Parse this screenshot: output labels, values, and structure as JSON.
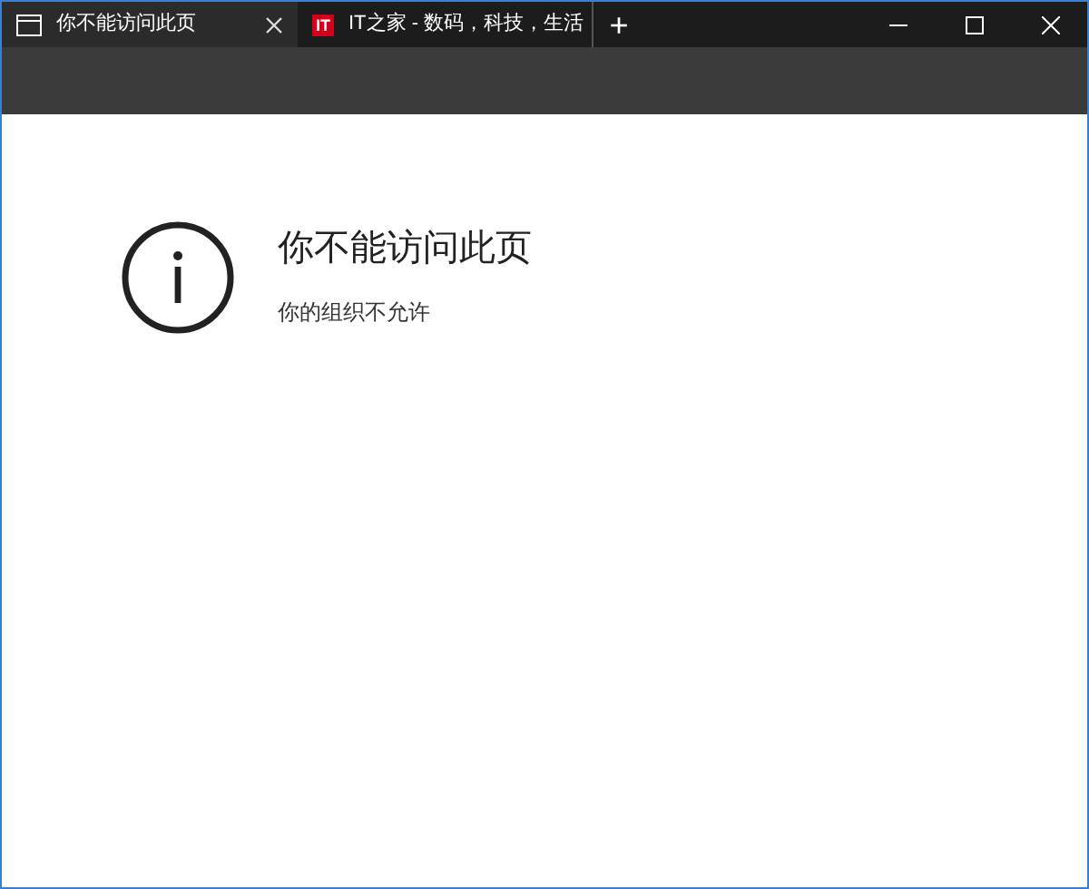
{
  "tabs": [
    {
      "title": "你不能访问此页",
      "selected": true,
      "kind": "page"
    },
    {
      "title": "IT之家 - 数码，科技，生活",
      "selected": false,
      "kind": "site",
      "logo": "IT"
    }
  ],
  "new_tab": "+",
  "page": {
    "title": "你不能访问此页",
    "message": "你的组织不允许"
  }
}
